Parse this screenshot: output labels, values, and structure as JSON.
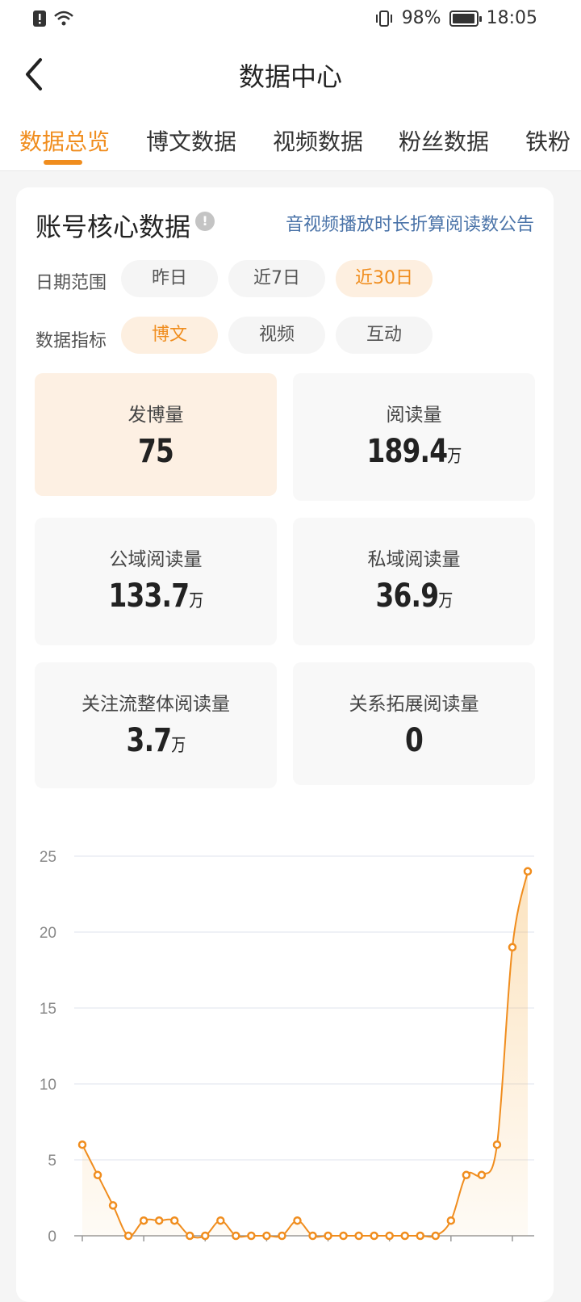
{
  "status_bar": {
    "battery": "98%",
    "time": "18:05",
    "battery_level": 0.98
  },
  "nav": {
    "title": "数据中心"
  },
  "tabs": [
    "数据总览",
    "博文数据",
    "视频数据",
    "粉丝数据",
    "铁粉"
  ],
  "section": {
    "title": "账号核心数据",
    "notice_link": "音视频播放时长折算阅读数公告",
    "date_label": "日期范围",
    "date_options": [
      "昨日",
      "近7日",
      "近30日"
    ],
    "date_selected": "近30日",
    "metric_label": "数据指标",
    "metric_options": [
      "博文",
      "视频",
      "互动"
    ],
    "metric_selected": "博文"
  },
  "stats": [
    {
      "label": "发博量",
      "value": "75",
      "unit": ""
    },
    {
      "label": "阅读量",
      "value": "189.4",
      "unit": "万"
    },
    {
      "label": "公域阅读量",
      "value": "133.7",
      "unit": "万"
    },
    {
      "label": "私域阅读量",
      "value": "36.9",
      "unit": "万"
    },
    {
      "label": "关注流整体阅读量",
      "value": "3.7",
      "unit": "万"
    },
    {
      "label": "关系拓展阅读量",
      "value": "0",
      "unit": ""
    }
  ],
  "colors": {
    "accent": "#f08d1e",
    "link": "#4a73a8"
  },
  "chart_data": {
    "type": "area",
    "ylim": [
      0,
      25
    ],
    "yticks": [
      0,
      5,
      10,
      15,
      20,
      25
    ],
    "grid": true,
    "series": [
      {
        "values": [
          6,
          4,
          2,
          0,
          1,
          1,
          1,
          0,
          0,
          1,
          0,
          0,
          0,
          0,
          1,
          0,
          0,
          0,
          0,
          0,
          0,
          0,
          0,
          0,
          1,
          4,
          4,
          6,
          19,
          24
        ]
      }
    ]
  }
}
